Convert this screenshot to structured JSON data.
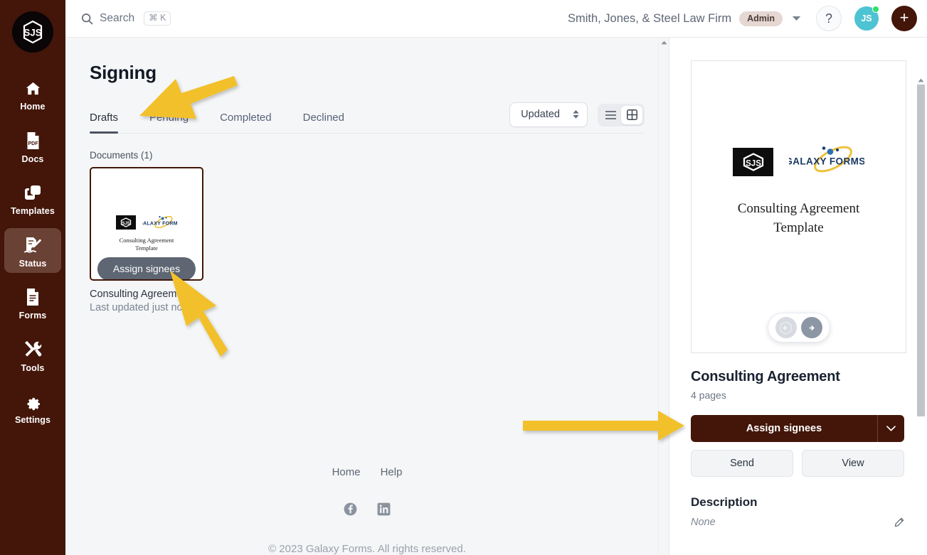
{
  "sidebar": {
    "logo_text": "SJS",
    "items": [
      {
        "label": "Home",
        "icon": "home-icon",
        "active": false
      },
      {
        "label": "Docs",
        "icon": "pdf-file-icon",
        "active": false
      },
      {
        "label": "Templates",
        "icon": "templates-icon",
        "active": false
      },
      {
        "label": "Status",
        "icon": "signature-icon",
        "active": true
      },
      {
        "label": "Forms",
        "icon": "form-icon",
        "active": false
      },
      {
        "label": "Tools",
        "icon": "tools-icon",
        "active": false
      },
      {
        "label": "Settings",
        "icon": "gear-icon",
        "active": false
      }
    ],
    "background_color": "#431609"
  },
  "header": {
    "search_label": "Search",
    "search_shortcut": "⌘ K",
    "org_name": "Smith, Jones, & Steel Law Firm",
    "role_badge": "Admin",
    "help_label": "?",
    "avatar_initials": "JS",
    "add_label": "+"
  },
  "main": {
    "page_title": "Signing",
    "tabs": [
      {
        "label": "Drafts",
        "active": true
      },
      {
        "label": "Pending",
        "active": false
      },
      {
        "label": "Completed",
        "active": false
      },
      {
        "label": "Declined",
        "active": false
      }
    ],
    "sort_value": "Updated",
    "view_modes": [
      {
        "name": "list-view",
        "active": false
      },
      {
        "name": "grid-view",
        "active": true
      }
    ],
    "section_label": "Documents (1)",
    "document": {
      "thumb_logo_text": "SJS",
      "thumb_brand": "GALAXY FORMS",
      "thumb_title_line1": "Consulting Agreement",
      "thumb_title_line2": "Template",
      "tooltip": "Assign signees",
      "name": "Consulting Agreement",
      "meta": "Last updated just now"
    }
  },
  "right_panel": {
    "preview": {
      "logo_text": "SJS",
      "brand": "GALAXY FORMS",
      "title_line1": "Consulting Agreement",
      "title_line2": "Template",
      "prev_label": "previous-page",
      "next_label": "next-page"
    },
    "doc_title": "Consulting Agreement",
    "doc_pages": "4 pages",
    "assign_button": "Assign signees",
    "send_button": "Send",
    "view_button": "View",
    "description_heading": "Description",
    "description_value": "None"
  },
  "footer": {
    "links": [
      "Home",
      "Help"
    ],
    "social": [
      "facebook-icon",
      "linkedin-icon"
    ],
    "copyright": "© 2023 Galaxy Forms. All rights reserved."
  },
  "annotations": {
    "arrow_color": "#f2c029",
    "arrows": [
      "arrow-to-drafts-tab",
      "arrow-to-card-tooltip",
      "arrow-to-assign-signees-button"
    ]
  }
}
